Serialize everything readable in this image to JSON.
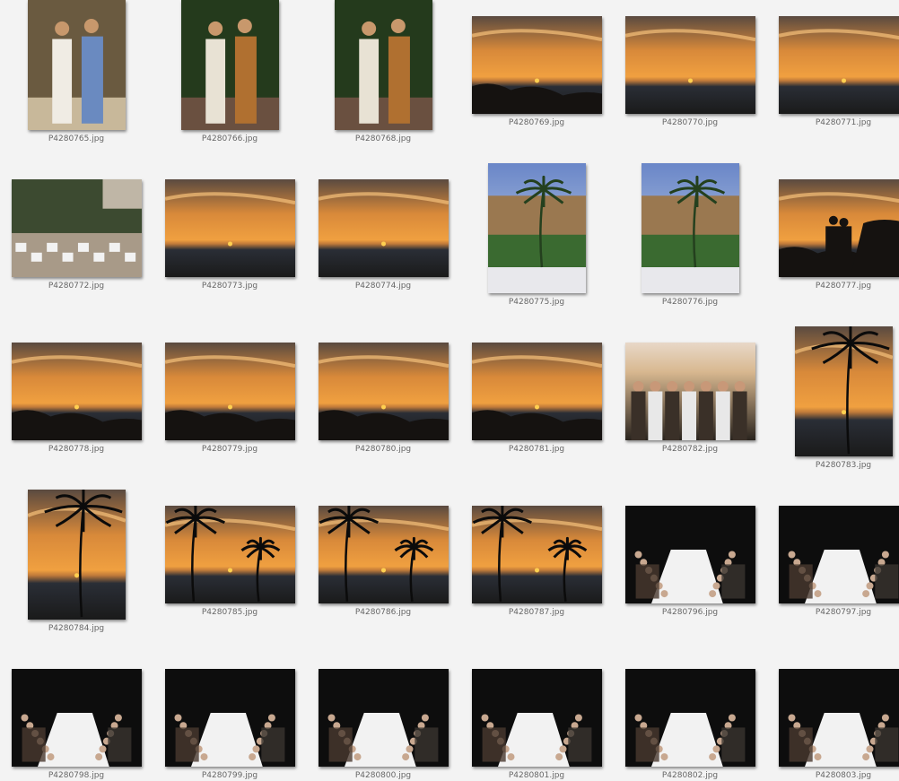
{
  "gallery": {
    "rows": [
      {
        "items": [
          {
            "name": "P4280765.jpg",
            "scene": "couple-beach"
          },
          {
            "name": "P4280766.jpg",
            "scene": "musicians"
          },
          {
            "name": "P4280768.jpg",
            "scene": "musicians"
          },
          {
            "name": "P4280769.jpg",
            "scene": "sunset-rocks"
          },
          {
            "name": "P4280770.jpg",
            "scene": "sunset-sea"
          },
          {
            "name": "P4280771.jpg",
            "scene": "sunset-sea"
          }
        ]
      },
      {
        "items": [
          {
            "name": "P4280772.jpg",
            "scene": "wedding-tables"
          },
          {
            "name": "P4280773.jpg",
            "scene": "sunset-sea"
          },
          {
            "name": "P4280774.jpg",
            "scene": "sunset-sea"
          },
          {
            "name": "P4280775.jpg",
            "scene": "hotel-palms"
          },
          {
            "name": "P4280776.jpg",
            "scene": "hotel-palms"
          },
          {
            "name": "P4280777.jpg",
            "scene": "silhouette-couple"
          }
        ]
      },
      {
        "items": [
          {
            "name": "P4280778.jpg",
            "scene": "sunset-rocks"
          },
          {
            "name": "P4280779.jpg",
            "scene": "sunset-rocks"
          },
          {
            "name": "P4280780.jpg",
            "scene": "sunset-rocks"
          },
          {
            "name": "P4280781.jpg",
            "scene": "sunset-rocks"
          },
          {
            "name": "P4280782.jpg",
            "scene": "group-photo"
          },
          {
            "name": "P4280783.jpg",
            "scene": "palm-sunset"
          }
        ]
      },
      {
        "items": [
          {
            "name": "P4280784.jpg",
            "scene": "palm-sunset"
          },
          {
            "name": "P4280785.jpg",
            "scene": "palm-sunset"
          },
          {
            "name": "P4280786.jpg",
            "scene": "palm-sunset"
          },
          {
            "name": "P4280787.jpg",
            "scene": "palm-sunset"
          },
          {
            "name": "P4280796.jpg",
            "scene": "night-dinner"
          },
          {
            "name": "P4280797.jpg",
            "scene": "night-dinner"
          }
        ]
      },
      {
        "items": [
          {
            "name": "P4280798.jpg",
            "scene": "night-dinner"
          },
          {
            "name": "P4280799.jpg",
            "scene": "night-dinner"
          },
          {
            "name": "P4280800.jpg",
            "scene": "night-dinner"
          },
          {
            "name": "P4280801.jpg",
            "scene": "night-dinner"
          },
          {
            "name": "P4280802.jpg",
            "scene": "night-dinner"
          },
          {
            "name": "P4280803.jpg",
            "scene": "night-dinner"
          }
        ]
      }
    ]
  },
  "colors": {
    "background": "#f3f3f3",
    "caption": "#666666",
    "sunset_sky_top": "#5a4a40",
    "sunset_sky_glow": "#f0a040",
    "sea": "#2a2e36",
    "night": "#0d0d0d",
    "tablecloth": "#f2f2f2"
  }
}
